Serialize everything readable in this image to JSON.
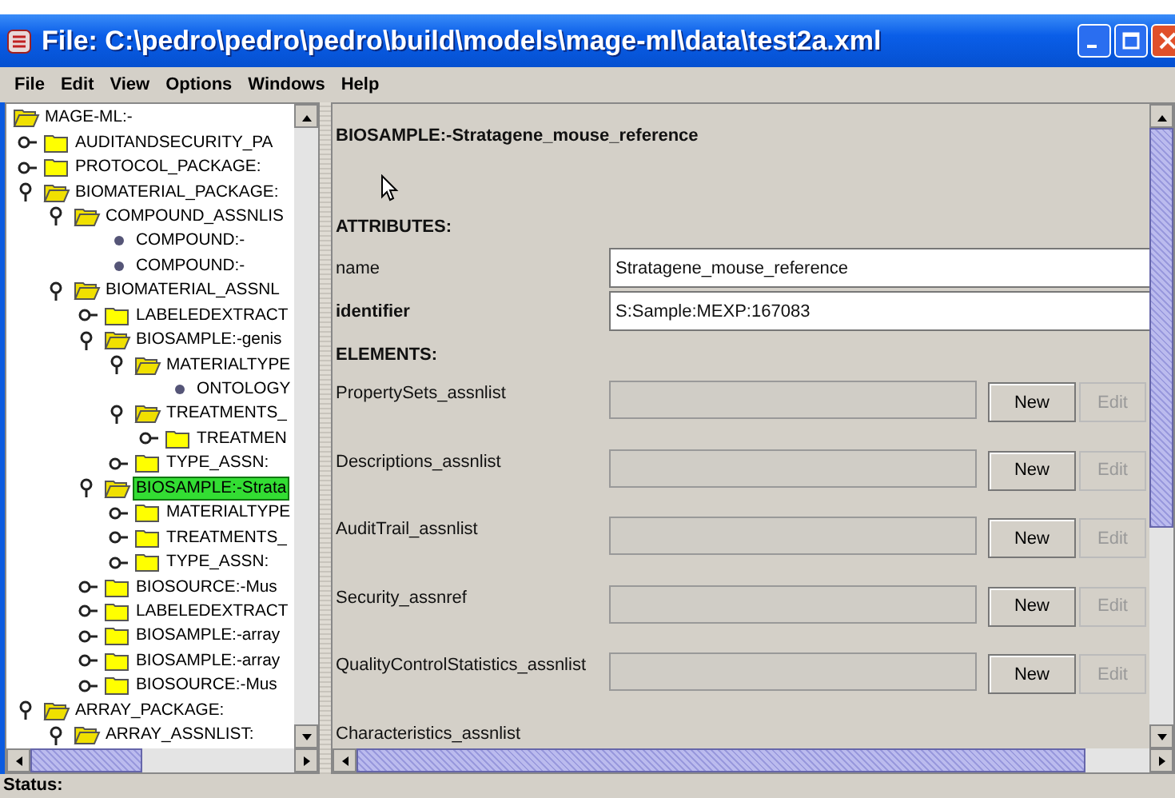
{
  "window": {
    "title": "File: C:\\pedro\\pedro\\pedro\\build\\models\\mage-ml\\data\\test2a.xml"
  },
  "menu": [
    "File",
    "Edit",
    "View",
    "Options",
    "Windows",
    "Help"
  ],
  "tree": {
    "label": "MAGE-ML:-",
    "kind": "folder",
    "expanded": true,
    "selected": false,
    "children": [
      {
        "label": "AUDITANDSECURITY_PA",
        "kind": "folder",
        "expanded": false,
        "selected": false
      },
      {
        "label": "PROTOCOL_PACKAGE:",
        "kind": "folder",
        "expanded": false,
        "selected": false
      },
      {
        "label": "BIOMATERIAL_PACKAGE:",
        "kind": "folder",
        "expanded": true,
        "selected": false,
        "children": [
          {
            "label": "COMPOUND_ASSNLIS",
            "kind": "folder",
            "expanded": true,
            "selected": false,
            "children": [
              {
                "label": "COMPOUND:-",
                "kind": "leaf",
                "selected": false
              },
              {
                "label": "COMPOUND:-",
                "kind": "leaf",
                "selected": false
              }
            ]
          },
          {
            "label": "BIOMATERIAL_ASSNL",
            "kind": "folder",
            "expanded": true,
            "selected": false,
            "children": [
              {
                "label": "LABELEDEXTRACT",
                "kind": "folder",
                "expanded": false,
                "selected": false
              },
              {
                "label": "BIOSAMPLE:-genis",
                "kind": "folder",
                "expanded": true,
                "selected": false,
                "children": [
                  {
                    "label": "MATERIALTYPE",
                    "kind": "folder",
                    "expanded": true,
                    "selected": false,
                    "children": [
                      {
                        "label": "ONTOLOGY",
                        "kind": "leaf",
                        "selected": false
                      }
                    ]
                  },
                  {
                    "label": "TREATMENTS_",
                    "kind": "folder",
                    "expanded": true,
                    "selected": false,
                    "children": [
                      {
                        "label": "TREATMEN",
                        "kind": "folder",
                        "expanded": false,
                        "selected": false
                      }
                    ]
                  },
                  {
                    "label": "TYPE_ASSN:",
                    "kind": "folder",
                    "expanded": false,
                    "selected": false
                  }
                ]
              },
              {
                "label": "BIOSAMPLE:-Strata",
                "kind": "folder",
                "expanded": true,
                "selected": true,
                "children": [
                  {
                    "label": "MATERIALTYPE",
                    "kind": "folder",
                    "expanded": false,
                    "selected": false
                  },
                  {
                    "label": "TREATMENTS_",
                    "kind": "folder",
                    "expanded": false,
                    "selected": false
                  },
                  {
                    "label": "TYPE_ASSN:",
                    "kind": "folder",
                    "expanded": false,
                    "selected": false
                  }
                ]
              },
              {
                "label": "BIOSOURCE:-Mus",
                "kind": "folder",
                "expanded": false,
                "selected": false
              },
              {
                "label": "LABELEDEXTRACT",
                "kind": "folder",
                "expanded": false,
                "selected": false
              },
              {
                "label": "BIOSAMPLE:-array",
                "kind": "folder",
                "expanded": false,
                "selected": false
              },
              {
                "label": "BIOSAMPLE:-array",
                "kind": "folder",
                "expanded": false,
                "selected": false
              },
              {
                "label": "BIOSOURCE:-Mus",
                "kind": "folder",
                "expanded": false,
                "selected": false
              }
            ]
          }
        ]
      },
      {
        "label": "ARRAY_PACKAGE:",
        "kind": "folder",
        "expanded": true,
        "selected": false,
        "children": [
          {
            "label": "ARRAY_ASSNLIST:",
            "kind": "folder",
            "expanded": true,
            "selected": false
          }
        ]
      }
    ]
  },
  "detail": {
    "heading": "BIOSAMPLE:-Stratagene_mouse_reference",
    "attributes_heading": "ATTRIBUTES:",
    "attributes": [
      {
        "label": "name",
        "value": "Stratagene_mouse_reference",
        "bold": false
      },
      {
        "label": "identifier",
        "value": "S:Sample:MEXP:167083",
        "bold": true
      }
    ],
    "elements_heading": "ELEMENTS:",
    "elements": [
      {
        "label": "PropertySets_assnlist",
        "new_button": {
          "label": "New",
          "disabled": false
        },
        "edit_button": {
          "label": "Edit",
          "disabled": true
        }
      },
      {
        "label": "Descriptions_assnlist",
        "new_button": {
          "label": "New",
          "disabled": false
        },
        "edit_button": {
          "label": "Edit",
          "disabled": true
        }
      },
      {
        "label": "AuditTrail_assnlist",
        "new_button": {
          "label": "New",
          "disabled": false
        },
        "edit_button": {
          "label": "Edit",
          "disabled": true
        }
      },
      {
        "label": "Security_assnref",
        "new_button": {
          "label": "New",
          "disabled": false
        },
        "edit_button": {
          "label": "Edit",
          "disabled": true
        }
      },
      {
        "label": "QualityControlStatistics_assnlist",
        "new_button": {
          "label": "New",
          "disabled": false
        },
        "edit_button": {
          "label": "Edit",
          "disabled": true
        }
      },
      {
        "label": "Characteristics_assnlist"
      }
    ]
  },
  "status_bar": {
    "label": "Status:"
  }
}
